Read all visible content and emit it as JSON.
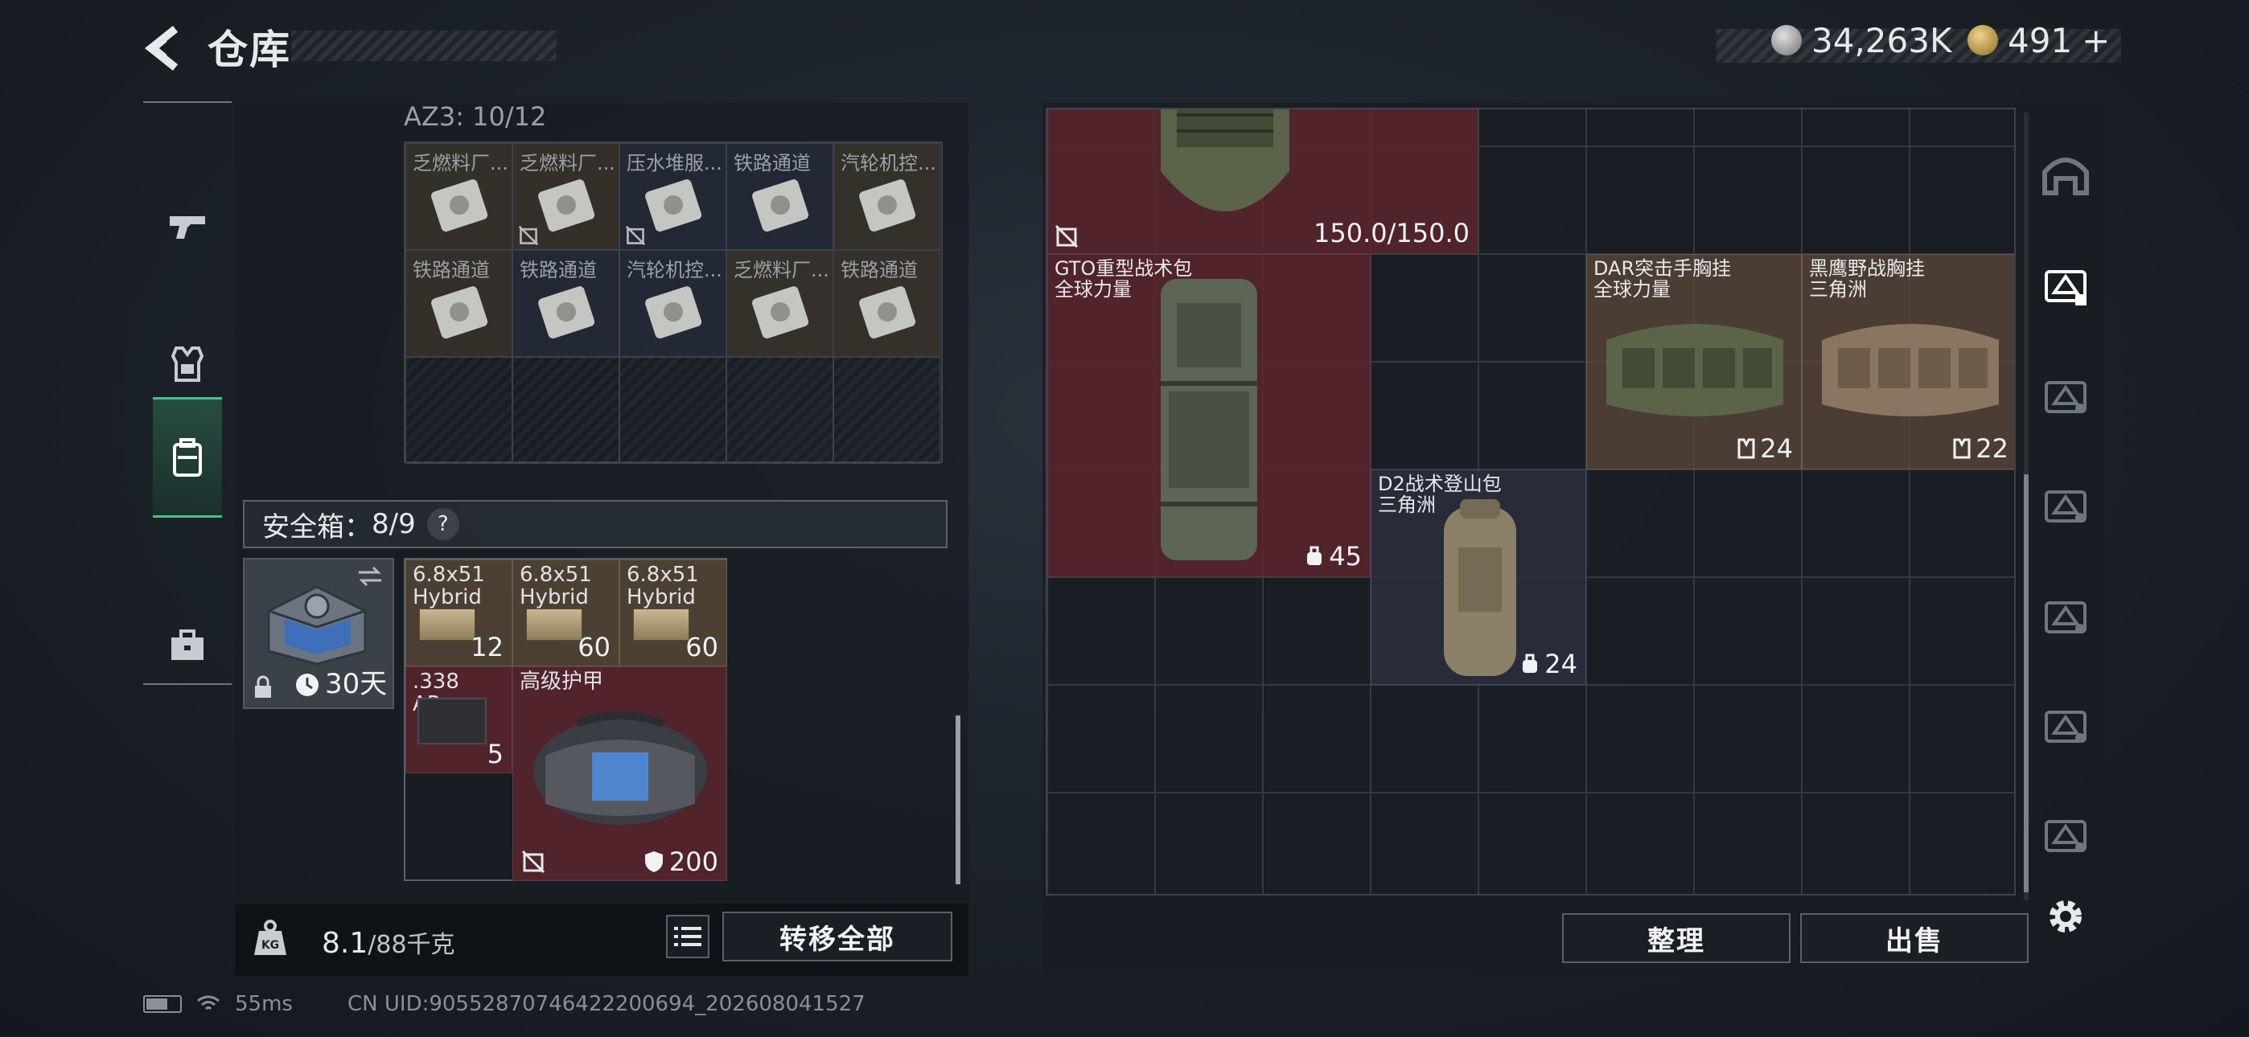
{
  "header": {
    "title": "仓库",
    "currency_silver": "34,263K",
    "currency_gold": "491",
    "plus": "+"
  },
  "left_nav": {
    "items": [
      {
        "icon": "pistol-icon"
      },
      {
        "icon": "armor-vest-icon"
      },
      {
        "icon": "backpack-icon",
        "active": true
      },
      {
        "icon": "briefcase-icon"
      }
    ]
  },
  "container": {
    "label": "AZ3: 10/12",
    "cells": [
      {
        "name": "乏燃料厂...",
        "note": ""
      },
      {
        "name": "乏燃料厂...",
        "note": "no-trade"
      },
      {
        "name": "压水堆服...",
        "note": "no-trade"
      },
      {
        "name": "铁路通道",
        "note": ""
      },
      {
        "name": "汽轮机控...",
        "note": ""
      },
      {
        "name": "铁路通道",
        "note": ""
      },
      {
        "name": "铁路通道",
        "note": ""
      },
      {
        "name": "汽轮机控...",
        "note": ""
      },
      {
        "name": "乏燃料厂...",
        "note": ""
      },
      {
        "name": "铁路通道",
        "note": ""
      }
    ]
  },
  "safe": {
    "label": "安全箱：",
    "count": "8/9",
    "help": "?",
    "duration": "30天",
    "items": [
      {
        "name": "6.8x51\nHybrid",
        "count": "12"
      },
      {
        "name": "6.8x51\nHybrid",
        "count": "60"
      },
      {
        "name": "6.8x51\nHybrid",
        "count": "60"
      },
      {
        "name": ".338\nAP",
        "count": "5"
      },
      {
        "name": "高级护甲",
        "count": "200"
      }
    ]
  },
  "weight": {
    "current": "8.1",
    "max": "/88千克"
  },
  "buttons": {
    "transfer_all": "转移全部",
    "sort": "整理",
    "sell": "出售"
  },
  "right_items": [
    {
      "name": "",
      "sub": "",
      "count": "150.0/150.0",
      "type": "vest"
    },
    {
      "name": "GTO重型战术包",
      "sub": "全球力量",
      "count": "45",
      "type": "backpack"
    },
    {
      "name": "DAR突击手胸挂",
      "sub": "全球力量",
      "count": "24",
      "type": "rig"
    },
    {
      "name": "黑鹰野战胸挂",
      "sub": "三角洲",
      "count": "22",
      "type": "rig"
    },
    {
      "name": "D2战术登山包",
      "sub": "三角洲",
      "count": "24",
      "type": "backpack"
    }
  ],
  "right_nav": [
    {
      "icon": "helmet-icon"
    },
    {
      "icon": "gti-vest-icon",
      "active": true
    },
    {
      "icon": "gti-gun-icon"
    },
    {
      "icon": "gti-grenade-icon"
    },
    {
      "icon": "iv-case-icon"
    },
    {
      "icon": "v-scope-icon"
    },
    {
      "icon": "v-rifle-icon"
    }
  ],
  "status": {
    "ping": "55ms",
    "uid": "CN UID:90552870746422200694_202608041527"
  },
  "colors": {
    "accent": "#3fc58a",
    "red_item": "#5c242c",
    "tan_item": "#5c4838"
  }
}
